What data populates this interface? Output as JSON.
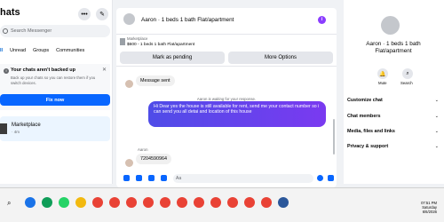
{
  "left": {
    "title": "hats",
    "more_icon_label": "•••",
    "compose_icon_label": "✎",
    "search_placeholder": "Search Messenger",
    "tabs": [
      "ll",
      "Unread",
      "Groups",
      "Communities"
    ],
    "backup": {
      "title": "Your chats aren't backed up",
      "description": "Back up your chats so you can restore them if you switch devices.",
      "close": "✕",
      "button": "Fix now"
    },
    "conversation": {
      "name": "Marketplace",
      "time": "· 4m"
    }
  },
  "chat": {
    "title": "Aaron · 1 beds 1 bath Flat/apartment",
    "info_icon": "i",
    "listing": {
      "source": "Marketplace",
      "price": "$600 - 1 beds 1 bath Flat/apartment"
    },
    "buttons": {
      "pending": "Mark as pending",
      "more": "More Options"
    },
    "messages": {
      "sent_label": "Message sent",
      "waiting": "Aaron is waiting for your response.",
      "outgoing": "Hi Dear yes the house is still available for rent, send me your contact number so i can send you all detai and location of this house",
      "sender": "Aaron",
      "incoming": "7204590964"
    },
    "composer_placeholder": "Aa"
  },
  "right": {
    "name": "Aaron · 1 beds 1 bath Flat/apartment",
    "mute_label": "Mute",
    "search_label": "Search",
    "sections": [
      "Customize chat",
      "Chat members",
      "Media, files and links",
      "Privacy & support"
    ]
  },
  "taskbar": {
    "time": "07:51 PM",
    "day": "Saturday",
    "date": "6/6/2026",
    "colors": [
      "#1a73e8",
      "#0f9d58",
      "#25d366",
      "#f2b90f",
      "#e94235",
      "#e94235",
      "#e94235",
      "#e94235",
      "#e94235",
      "#e94235",
      "#e94235",
      "#e94235",
      "#e94235",
      "#e94235",
      "#e94235",
      "#2b579a"
    ]
  }
}
